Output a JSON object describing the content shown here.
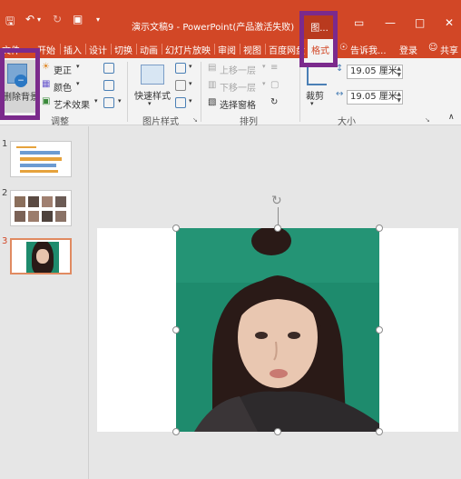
{
  "titlebar": {
    "title": "演示文稿9 - PowerPoint(产品激活失败)",
    "context_tab": "图...",
    "icons": [
      "save-icon",
      "undo-icon",
      "redo-icon",
      "present-icon",
      "customize-icon",
      "ribbon-display-icon",
      "minimize-icon",
      "maximize-icon",
      "close-icon"
    ]
  },
  "tabs": {
    "file": "文件",
    "items": [
      "开始",
      "插入",
      "设计",
      "切换",
      "动画",
      "幻灯片放映",
      "审阅",
      "视图",
      "百度网盘"
    ],
    "format": "格式",
    "tell_me": "告诉我...",
    "login": "登录",
    "share": "共享"
  },
  "ribbon": {
    "adjust": {
      "remove_bg": "删除背景",
      "corrections": "更正",
      "color": "颜色",
      "artistic": "艺术效果",
      "label": "调整"
    },
    "picture_styles": {
      "quick_styles": "快速样式",
      "label": "图片样式"
    },
    "arrange": {
      "bring_forward": "上移一层",
      "send_backward": "下移一层",
      "selection_pane": "选择窗格",
      "label": "排列"
    },
    "size": {
      "crop": "裁剪",
      "height": "19.05 厘米",
      "width": "19.05 厘米",
      "label": "大小"
    }
  },
  "slides": {
    "numbers": [
      "1",
      "2",
      "3"
    ],
    "active": 3
  },
  "colors": {
    "accent": "#d24726",
    "highlight": "#7b2a8c",
    "picture_bg": "#1e8b6d"
  }
}
